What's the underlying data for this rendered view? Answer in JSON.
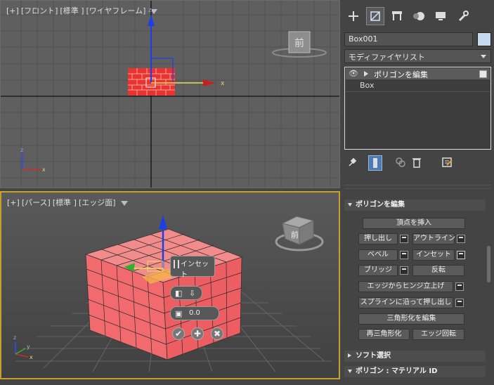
{
  "viewport_front": {
    "labels": [
      "[+]",
      "[フロント]",
      "[標準 ]",
      "[ワイヤフレーム]"
    ],
    "viewcube_label": "前",
    "axis_x": "x",
    "axis_z": "z"
  },
  "viewport_persp": {
    "labels": [
      "[+]",
      "[パース]",
      "[標準 ]",
      "[エッジ面]"
    ],
    "viewcube_label": "前",
    "caddy_title": "インセット",
    "caddy_value": "0.0"
  },
  "panel": {
    "object_name": "Box001",
    "object_color": "#c5d9ef",
    "modifier_list": "モディファイヤリスト",
    "stack_items": [
      "ポリゴンを編集",
      "Box"
    ],
    "rollout_edit_poly": {
      "title": "ポリゴンを編集",
      "insert_vertex": "頂点を挿入",
      "extrude": "押し出し",
      "outline": "アウトライン",
      "bevel": "ベベル",
      "inset": "インセット",
      "bridge": "ブリッジ",
      "flip": "反転",
      "hinge": "エッジからヒンジ立上げ",
      "extrude_spline": "スプラインに沿って押し出し",
      "edit_tri": "三角形化を編集",
      "retriangulate": "再三角形化",
      "turn": "エッジ回転"
    },
    "rollout_soft": "ソフト選択",
    "rollout_matid": "ポリゴン : マテリアル ID"
  },
  "colors": {
    "box_red": "#e8332f",
    "box_pink": "#f57a7a",
    "selection_yellow": "#c79f2e",
    "gizmo_blue": "#1d3fe6"
  }
}
